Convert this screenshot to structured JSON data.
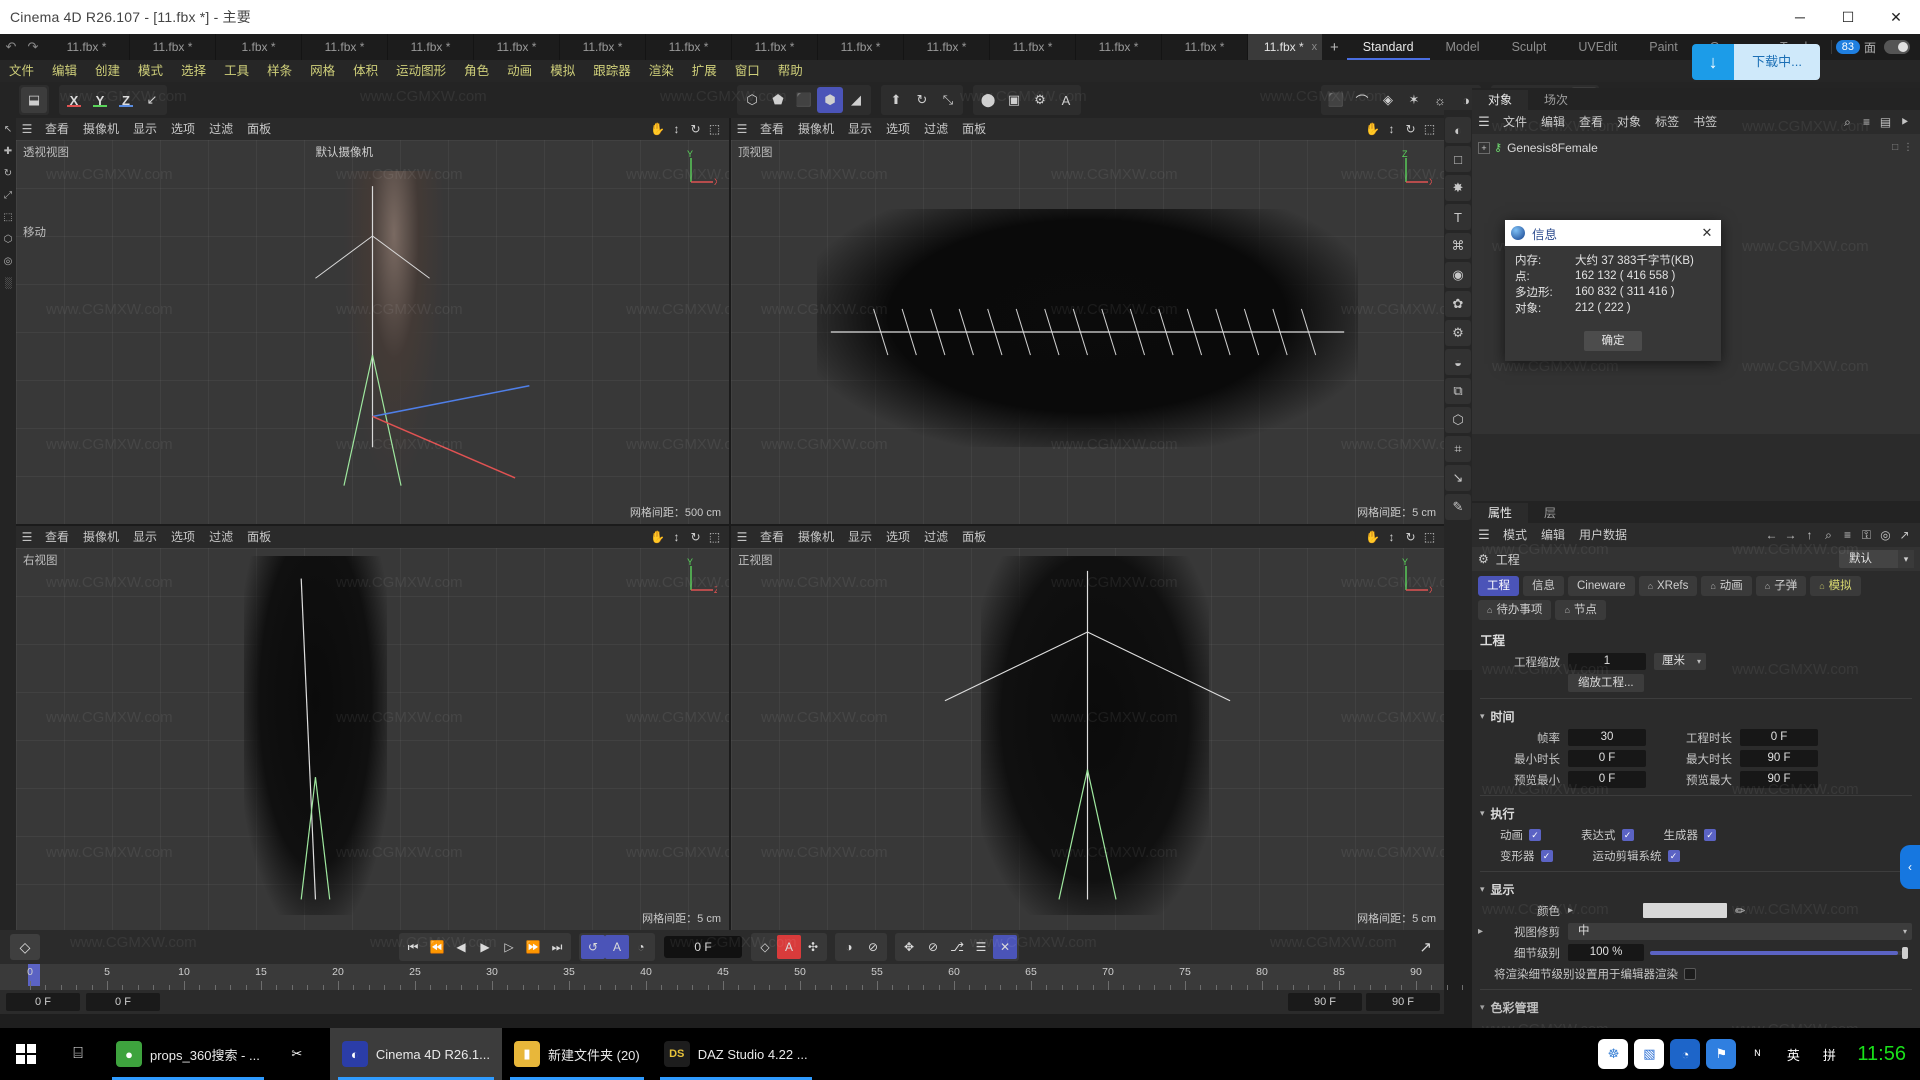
{
  "window": {
    "title": "Cinema 4D R26.107 - [11.fbx *] - 主要",
    "minimize": "─",
    "maximize": "☐",
    "close": "✕"
  },
  "doc_tabs": {
    "undo_icon": "↶",
    "redo_icon": "↷",
    "items": [
      {
        "label": "11.fbx *"
      },
      {
        "label": "11.fbx *"
      },
      {
        "label": "1.fbx *"
      },
      {
        "label": "11.fbx *"
      },
      {
        "label": "11.fbx *"
      },
      {
        "label": "11.fbx *"
      },
      {
        "label": "11.fbx *"
      },
      {
        "label": "11.fbx *"
      },
      {
        "label": "11.fbx *"
      },
      {
        "label": "11.fbx *"
      },
      {
        "label": "11.fbx *"
      },
      {
        "label": "11.fbx *"
      },
      {
        "label": "11.fbx *"
      },
      {
        "label": "11.fbx *"
      }
    ],
    "active_label": "11.fbx *",
    "close_x": "x",
    "add_tab": "+"
  },
  "layout_tabs": {
    "add": "+",
    "items": [
      {
        "label": "Standard",
        "active": true
      },
      {
        "label": "Model",
        "active": false
      },
      {
        "label": "Sculpt",
        "active": false
      },
      {
        "label": "UVEdit",
        "active": false
      },
      {
        "label": "Paint",
        "active": false
      },
      {
        "label": "Groom",
        "active": false
      },
      {
        "label": "Track",
        "active": false
      }
    ],
    "badge": "83",
    "page_label": "面"
  },
  "download_toast": {
    "icon": "↓",
    "label": "下载中..."
  },
  "menu": {
    "items": [
      "文件",
      "编辑",
      "创建",
      "模式",
      "选择",
      "工具",
      "样条",
      "网格",
      "体积",
      "运动图形",
      "角色",
      "动画",
      "模拟",
      "跟踪器",
      "渲染",
      "扩展",
      "窗口",
      "帮助"
    ]
  },
  "toolbar": {
    "groups": [
      {
        "buttons": [
          {
            "icon": "⬓",
            "name": "undo-redo-box",
            "state": "lit"
          }
        ]
      },
      {
        "buttons": [
          {
            "icon": "X",
            "name": "axis-x",
            "state": "axis",
            "color": "#e05252"
          },
          {
            "icon": "Y",
            "name": "axis-y",
            "state": "axis",
            "color": "#5ad45a"
          },
          {
            "icon": "Z",
            "name": "axis-z",
            "state": "axis",
            "color": "#5a8ce0"
          },
          {
            "icon": "↙",
            "name": "world-object-axis",
            "state": ""
          }
        ]
      },
      {
        "buttons": [
          {
            "icon": "⬡",
            "name": "point-mode",
            "state": ""
          },
          {
            "icon": "⬟",
            "name": "edge-mode",
            "state": ""
          },
          {
            "icon": "⬛",
            "name": "polygon-mode",
            "state": ""
          },
          {
            "icon": "⬢",
            "name": "model-mode",
            "state": "on"
          },
          {
            "icon": "◢",
            "name": "texture-mode",
            "state": ""
          }
        ]
      },
      {
        "buttons": [
          {
            "icon": "⬆",
            "name": "move-tool",
            "state": ""
          },
          {
            "icon": "↻",
            "name": "rotate-tool",
            "state": ""
          },
          {
            "icon": "⤡",
            "name": "scale-tool",
            "state": ""
          }
        ]
      },
      {
        "buttons": [
          {
            "icon": "⬤",
            "name": "render-view",
            "state": ""
          },
          {
            "icon": "▣",
            "name": "render-region",
            "state": ""
          },
          {
            "icon": "⚙",
            "name": "render-settings",
            "state": ""
          },
          {
            "icon": "A",
            "name": "asset-browser",
            "state": ""
          }
        ]
      },
      {
        "buttons": [
          {
            "icon": "⬛",
            "name": "cube-primitive",
            "state": ""
          },
          {
            "icon": "⌒",
            "name": "spline-pen",
            "state": ""
          },
          {
            "icon": "◈",
            "name": "generator",
            "state": ""
          },
          {
            "icon": "✶",
            "name": "deformer",
            "state": ""
          },
          {
            "icon": "☼",
            "name": "light",
            "state": ""
          },
          {
            "icon": "◑",
            "name": "camera",
            "state": ""
          }
        ]
      },
      {
        "buttons": [
          {
            "icon": "▭",
            "name": "render-queue",
            "state": ""
          },
          {
            "icon": "▶",
            "name": "render-to-pv",
            "state": ""
          },
          {
            "icon": "⚙",
            "name": "render-config",
            "state": ""
          },
          {
            "icon": "◯",
            "name": "material-ball",
            "state": "lit"
          }
        ]
      }
    ]
  },
  "left_rail": {
    "buttons": [
      "↖",
      "✚",
      "↻",
      "⤢",
      "⬚",
      "⬡",
      "◎",
      "░"
    ]
  },
  "viewports": {
    "menu_items": [
      "查看",
      "摄像机",
      "显示",
      "选项",
      "过滤",
      "面板"
    ],
    "menu_hamburger": "☰",
    "nav_icons": [
      "✋",
      "↕",
      "↻",
      "⬚"
    ],
    "panels": [
      {
        "name": "perspective",
        "label": "透视视图",
        "camera": "默认摄像机",
        "grid": "网格间距：500 cm",
        "move_hint": "移动"
      },
      {
        "name": "top",
        "label": "顶视图",
        "camera": "",
        "grid": "网格间距：5 cm",
        "move_hint": ""
      },
      {
        "name": "right",
        "label": "右视图",
        "camera": "",
        "grid": "网格间距：5 cm",
        "move_hint": ""
      },
      {
        "name": "front",
        "label": "正视图",
        "camera": "",
        "grid": "网格间距：5 cm",
        "move_hint": ""
      }
    ]
  },
  "timeline": {
    "keyframe_icon": "◇",
    "transport": [
      {
        "icon": "⏮",
        "name": "go-to-start"
      },
      {
        "icon": "⏪",
        "name": "previous-key"
      },
      {
        "icon": "◀",
        "name": "step-back"
      },
      {
        "icon": "▶",
        "name": "play"
      },
      {
        "icon": "▷",
        "name": "step-forward"
      },
      {
        "icon": "⏩",
        "name": "next-key"
      },
      {
        "icon": "⏭",
        "name": "go-to-end"
      }
    ],
    "loop_group": [
      {
        "icon": "↺",
        "name": "loop-playback",
        "on": true
      },
      {
        "icon": "A",
        "name": "autokey-range",
        "on": true
      },
      {
        "icon": "◔",
        "name": "sound",
        "on": false
      }
    ],
    "current_frame": "0 F",
    "record_group": [
      {
        "icon": "◇",
        "name": "record-active-objects",
        "on": false
      },
      {
        "icon": "A",
        "name": "autokeying",
        "on": false,
        "accent": "#d83b3b"
      },
      {
        "icon": "✣",
        "name": "keyframe-selection",
        "on": false
      }
    ],
    "param_group": [
      {
        "icon": "◑",
        "name": "position-key",
        "on": false
      },
      {
        "icon": "⊘",
        "name": "scale-key",
        "on": false
      }
    ],
    "extra_group": [
      {
        "icon": "✥",
        "name": "point-level-animation",
        "on": false
      },
      {
        "icon": "⊘",
        "name": "param-level-animation",
        "on": false
      },
      {
        "icon": "⎇",
        "name": "key-interpolation",
        "on": false
      },
      {
        "icon": "☰",
        "name": "dope-sheet",
        "on": false
      },
      {
        "icon": "✕",
        "name": "motion-clip",
        "on": true
      }
    ],
    "ruler_ticks": [
      0,
      5,
      10,
      15,
      20,
      25,
      30,
      35,
      40,
      45,
      50,
      55,
      60,
      65,
      70,
      75,
      80,
      85,
      90
    ],
    "footer_left": "0 F",
    "footer_left2": "0 F",
    "footer_right": "90 F",
    "footer_right2": "90 F",
    "curve_icon": "↗"
  },
  "rail": {
    "buttons": [
      {
        "icon": "◐",
        "name": "content-browser-rail"
      },
      {
        "icon": "□",
        "name": "square-rail"
      },
      {
        "icon": "✸",
        "name": "structure-rail"
      },
      {
        "icon": "T",
        "name": "text-rail"
      },
      {
        "icon": "⌘",
        "name": "nodes-rail"
      },
      {
        "icon": "◉",
        "name": "material-rail"
      },
      {
        "icon": "✿",
        "name": "sculpt-rail"
      },
      {
        "icon": "⚙",
        "name": "settings-rail"
      },
      {
        "icon": "◒",
        "name": "uv-rail"
      },
      {
        "icon": "⧉",
        "name": "layer-rail"
      },
      {
        "icon": "⬡",
        "name": "takes-rail"
      },
      {
        "icon": "⌗",
        "name": "grid-rail"
      },
      {
        "icon": "↘",
        "name": "xpresso-rail"
      },
      {
        "icon": "✎",
        "name": "pen-rail"
      }
    ]
  },
  "object_manager": {
    "tabs": [
      {
        "label": "对象",
        "active": true
      },
      {
        "label": "场次",
        "active": false
      }
    ],
    "hamburger": "☰",
    "menu": [
      "文件",
      "编辑",
      "查看",
      "对象",
      "标签",
      "书签"
    ],
    "right_icons": [
      "⌕",
      "≡",
      "▤",
      "⯈"
    ],
    "objects": [
      {
        "expander": "+",
        "icon": "⚷",
        "label": "Genesis8Female",
        "tags": "□ ⋮"
      }
    ]
  },
  "info_dialog": {
    "title": "信息",
    "close": "✕",
    "rows": [
      {
        "key": "内存:",
        "value": "大约 37 383千字节(KB)"
      },
      {
        "key": "点:",
        "value": "162 132 ( 416 558 )"
      },
      {
        "key": "多边形:",
        "value": "160 832 ( 311 416 )"
      },
      {
        "key": "对象:",
        "value": "212 ( 222 )"
      }
    ],
    "ok": "确定"
  },
  "attributes": {
    "tabs": [
      {
        "label": "属性",
        "active": true
      },
      {
        "label": "层",
        "active": false
      }
    ],
    "hamburger": "☰",
    "menu": [
      "模式",
      "编辑",
      "用户数据"
    ],
    "right_icons": [
      "←",
      "→",
      "↑",
      "⌕",
      "≡",
      "⚿",
      "◎",
      "↗"
    ],
    "header_icon": "⚙",
    "header_title": "工程",
    "preset": "默认",
    "chips": [
      {
        "label": "工程",
        "sel": true,
        "bell": false,
        "ylw": false
      },
      {
        "label": "信息",
        "sel": false,
        "bell": false,
        "ylw": false
      },
      {
        "label": "Cineware",
        "sel": false,
        "bell": false,
        "ylw": false
      },
      {
        "label": "XRefs",
        "sel": false,
        "bell": true,
        "ylw": false
      },
      {
        "label": "动画",
        "sel": false,
        "bell": true,
        "ylw": false
      },
      {
        "label": "子弹",
        "sel": false,
        "bell": true,
        "ylw": false
      },
      {
        "label": "模拟",
        "sel": false,
        "bell": true,
        "ylw": true
      },
      {
        "label": "待办事项",
        "sel": false,
        "bell": true,
        "ylw": false
      },
      {
        "label": "节点",
        "sel": false,
        "bell": true,
        "ylw": false
      }
    ],
    "section_project": {
      "title": "工程",
      "scale_label": "工程缩放",
      "scale_value": "1",
      "unit": "厘米",
      "scale_button": "缩放工程..."
    },
    "section_time": {
      "title": "时间",
      "rows": [
        {
          "l1": "帧率",
          "v1": "30",
          "l2": "工程时长",
          "v2": "0 F"
        },
        {
          "l1": "最小时长",
          "v1": "0 F",
          "l2": "最大时长",
          "v2": "90 F"
        },
        {
          "l1": "预览最小",
          "v1": "0 F",
          "l2": "预览最大",
          "v2": "90 F"
        }
      ]
    },
    "section_exec": {
      "title": "执行",
      "row1": [
        {
          "label": "动画",
          "checked": true
        },
        {
          "label": "表达式",
          "checked": true
        },
        {
          "label": "生成器",
          "checked": true
        }
      ],
      "row2": [
        {
          "label": "变形器",
          "checked": true
        },
        {
          "label": "运动剪辑系统",
          "checked": true
        }
      ]
    },
    "section_display": {
      "title": "显示",
      "color_label": "颜色",
      "color_value": "#d8d8d8",
      "clip_label": "视图修剪",
      "clip_value": "中",
      "lod_label": "细节级别",
      "lod_value": "100 %",
      "render_lod_label": "将渲染细节级别设置用于编辑器渲染",
      "render_lod_checked": false,
      "next_section": "色彩管理"
    }
  },
  "taskbar": {
    "start_icon": "⊞",
    "search_icon": "⌸",
    "items": [
      {
        "label": "props_360搜索 - ...",
        "icon": "●",
        "color": "#3ea33e",
        "active": false,
        "underline": true
      },
      {
        "label": "",
        "icon": "✂",
        "color": "transparent",
        "active": false,
        "underline": false
      },
      {
        "label": "Cinema 4D R26.1...",
        "icon": "◐",
        "color": "#2b3da8",
        "active": true,
        "underline": true
      },
      {
        "label": "新建文件夹 (20)",
        "icon": "▮",
        "color": "#e8b73a",
        "active": false,
        "underline": true
      },
      {
        "label": "DAZ Studio 4.22 ...",
        "icon": "DS",
        "color": "#1d1d1d",
        "active": false,
        "underline": true
      }
    ],
    "tray": [
      {
        "icon": "☸",
        "name": "cloud-drive-tray",
        "color": "#ffffff",
        "fg": "#3b82d6"
      },
      {
        "icon": "▧",
        "name": "folder-tray",
        "color": "#ffffff",
        "fg": "#2b6fd4"
      },
      {
        "icon": "◔",
        "name": "browser-tray",
        "color": "#1d65c9",
        "fg": "#ffffff"
      },
      {
        "icon": "⚑",
        "name": "app-tray",
        "color": "#2f7fe0",
        "fg": "#ffffff"
      },
      {
        "icon": "ᴺ",
        "name": "volume-icon",
        "color": "transparent",
        "fg": "#ffffff"
      },
      {
        "icon": "英",
        "name": "ime-language",
        "color": "transparent",
        "fg": "#ffffff"
      },
      {
        "icon": "拼",
        "name": "ime-pinyin",
        "color": "transparent",
        "fg": "#ffffff"
      }
    ],
    "clock": "11:56"
  },
  "watermark": "www.CGMXW.com",
  "pull_tab": "‹"
}
